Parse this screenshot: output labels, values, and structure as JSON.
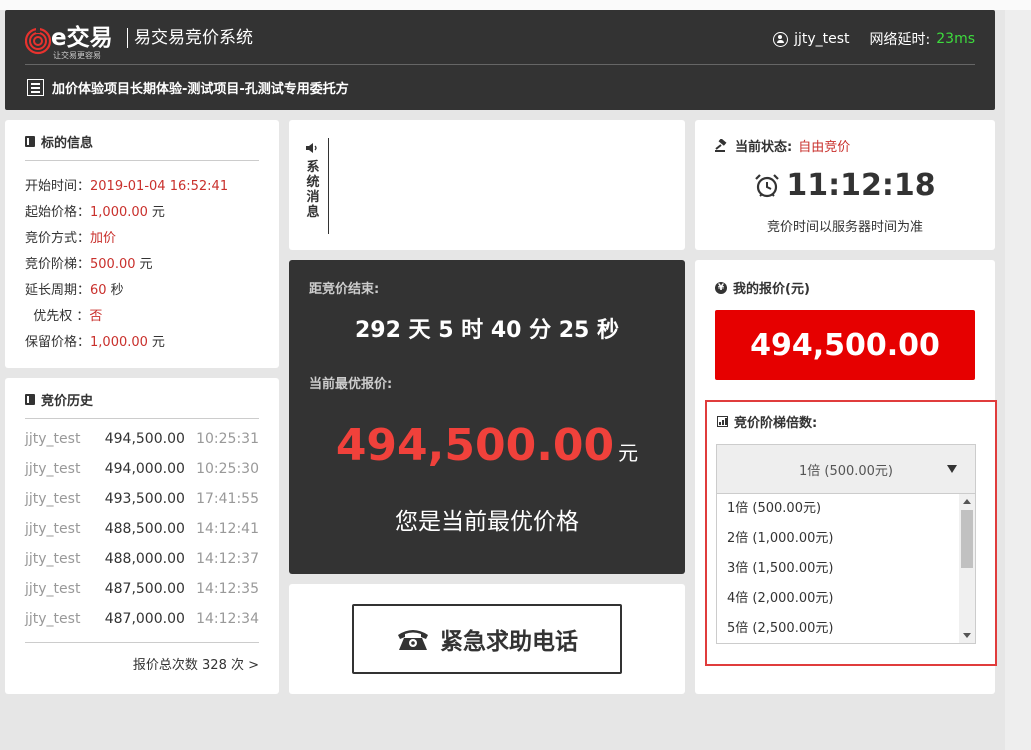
{
  "header": {
    "brand": "e交易",
    "slogan": "让交易更容易",
    "system_title": "易交易竞价系统",
    "username": "jjty_test",
    "latency_label": "网络延时:",
    "latency_value": "23ms",
    "project_name": "加价体验项目长期体验-测试项目-孔测试专用委托方"
  },
  "info": {
    "title": "标的信息",
    "rows": [
      {
        "label": "开始时间：",
        "value": "2019-01-04 16:52:41",
        "unit": ""
      },
      {
        "label": "起始价格：",
        "value": "1,000.00",
        "unit": "元"
      },
      {
        "label": "竞价方式：",
        "value": "加价",
        "unit": ""
      },
      {
        "label": "竞价阶梯：",
        "value": "500.00",
        "unit": "元"
      },
      {
        "label": "延长周期：",
        "value": "60",
        "unit": "秒"
      },
      {
        "label": "  优先权 ：",
        "value": "否",
        "unit": ""
      },
      {
        "label": "保留价格：",
        "value": "1,000.00",
        "unit": "元"
      }
    ]
  },
  "history": {
    "title": "竞价历史",
    "rows": [
      {
        "user": "jjty_test",
        "price": "494,500.00",
        "time": "10:25:31"
      },
      {
        "user": "jjty_test",
        "price": "494,000.00",
        "time": "10:25:30"
      },
      {
        "user": "jjty_test",
        "price": "493,500.00",
        "time": "17:41:55"
      },
      {
        "user": "jjty_test",
        "price": "488,500.00",
        "time": "14:12:41"
      },
      {
        "user": "jjty_test",
        "price": "488,000.00",
        "time": "14:12:37"
      },
      {
        "user": "jjty_test",
        "price": "487,500.00",
        "time": "14:12:35"
      },
      {
        "user": "jjty_test",
        "price": "487,000.00",
        "time": "14:12:34"
      }
    ],
    "total": "报价总次数 328 次 >"
  },
  "sysmsg": {
    "label": "系统消息"
  },
  "countdown": {
    "label": "距竞价结束:",
    "value": "292 天 5 时 40 分 25 秒",
    "best_label": "当前最优报价:",
    "best_value": "494,500.00",
    "best_unit": "元",
    "best_message": "您是当前最优价格"
  },
  "emergency": {
    "label": "紧急求助电话"
  },
  "status": {
    "label": "当前状态:",
    "value": "自由竞价",
    "time": "11:12:18",
    "note": "竞价时间以服务器时间为准"
  },
  "mybid": {
    "title": "我的报价(元)",
    "value": "494,500.00",
    "step_title": "竞价阶梯倍数:",
    "selected": "1倍 (500.00元)",
    "options": [
      "1倍 (500.00元)",
      "2倍 (1,000.00元)",
      "3倍 (1,500.00元)",
      "4倍 (2,000.00元)",
      "5倍 (2,500.00元)"
    ]
  },
  "colors": {
    "dark_panel": "#333333",
    "accent_red": "#e60000",
    "price_red": "#f0413b",
    "latency_green": "#3ddc3d",
    "highlight_border": "#e03c3c"
  }
}
